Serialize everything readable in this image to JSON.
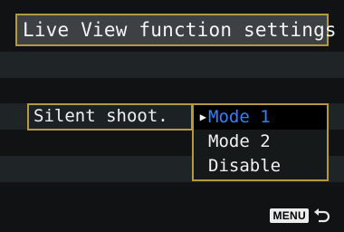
{
  "header": {
    "title": "Live View function settings"
  },
  "setting": {
    "label": "Silent shoot."
  },
  "dropdown": {
    "options": [
      {
        "label": "Mode 1",
        "selected": true
      },
      {
        "label": "Mode 2",
        "selected": false
      },
      {
        "label": "Disable",
        "selected": false
      }
    ]
  },
  "footer": {
    "menu_label": "MENU",
    "return_icon": "return-arrow-icon"
  },
  "colors": {
    "accent_border": "#b49a3f",
    "selected_text": "#2f82ff",
    "title_bg": "#3d4143"
  }
}
